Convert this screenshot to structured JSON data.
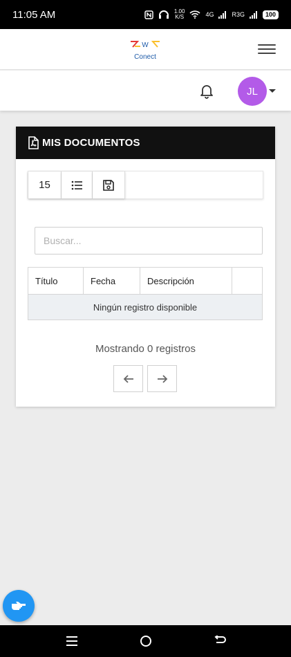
{
  "status": {
    "time": "11:05 AM",
    "speed_value": "1.00",
    "speed_unit": "K/S",
    "net1": "4G",
    "net2": "R3G",
    "battery": "100"
  },
  "header": {
    "logo_letter": "W",
    "logo_text": "Conect"
  },
  "user": {
    "initials": "JL"
  },
  "card": {
    "title": "MIS DOCUMENTOS"
  },
  "toolbar": {
    "page_size": "15"
  },
  "search": {
    "placeholder": "Buscar...",
    "value": ""
  },
  "table": {
    "columns": [
      "Título",
      "Fecha",
      "Descripción",
      ""
    ],
    "empty_message": "Ningún registro disponible"
  },
  "footer": {
    "count_text": "Mostrando 0 registros"
  },
  "colors": {
    "avatar": "#b35be8",
    "header": "#111111",
    "fab": "#2196f3"
  }
}
